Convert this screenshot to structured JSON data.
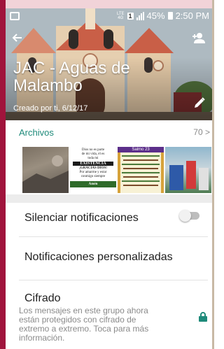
{
  "status_bar": {
    "network_top": "LTE",
    "network_sub": "4G",
    "sim_slot": "1",
    "battery": "45%",
    "time": "2:50 PM"
  },
  "header": {
    "group_name": "JAC - Aguas de Malambo",
    "created_by": "Creado por ti, 6/12/17"
  },
  "files": {
    "label": "Archivos",
    "count": "70 >"
  },
  "thumb_text": {
    "t2_line1": "Dios no es parte",
    "t2_line2": "de mi vida, él es",
    "t2_line3": "toda mi",
    "t2_banner": "EXISTENCIA",
    "t2_line4": "¡GRACIAS DIOS!",
    "t2_line5": "Por amarme y estar",
    "t2_line6": "conmigo siempre",
    "t2_footer": "Amén",
    "t3_title": "Salmo 23"
  },
  "settings": {
    "mute_label": "Silenciar notificaciones",
    "mute_state": "off",
    "custom_notif_label": "Notificaciones personalizadas",
    "encryption_title": "Cifrado",
    "encryption_desc": "Los mensajes en este grupo ahora están protegidos con cifrado de extremo a extremo. Toca para más información."
  },
  "colors": {
    "accent": "#1e8a7a",
    "frame": "#a0143c"
  },
  "icons": [
    "back-arrow-icon",
    "add-person-icon",
    "pencil-icon",
    "lock-icon",
    "sim-icon",
    "signal-icon",
    "battery-icon"
  ]
}
